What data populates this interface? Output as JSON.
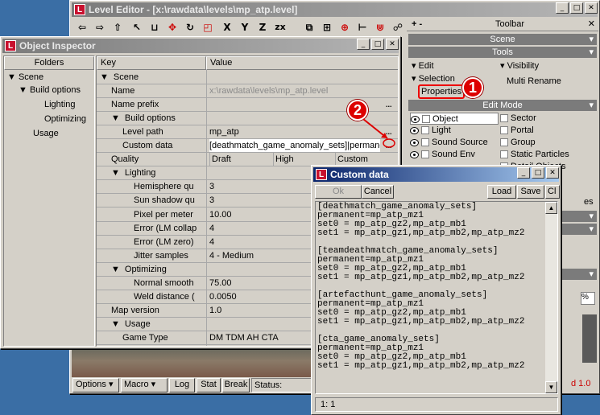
{
  "level_editor": {
    "title": "Level Editor - [x:\\rawdata\\levels\\mp_atp.level]",
    "statusbar": [
      "Options",
      "Macro",
      "Log",
      "Stat",
      "Break",
      "Status:"
    ],
    "status_right": "d 1.0"
  },
  "toolbar_panel": {
    "toolbar_label": "Toolbar",
    "scene_label": "Scene",
    "tools_label": "Tools",
    "edit_label": "Edit",
    "visibility_label": "Visibility",
    "selection_label": "Selection",
    "multi_rename_label": "Multi Rename",
    "properties_label": "Properties",
    "edit_mode_label": "Edit Mode",
    "left_items": [
      "Object",
      "Light",
      "Sound Source",
      "Sound Env"
    ],
    "right_items": [
      "Sector",
      "Portal",
      "Group",
      "Static Particles",
      "Detail Objects"
    ],
    "partial_text": "es",
    "plus_minus": "+ -"
  },
  "object_inspector": {
    "title": "Object Inspector",
    "folders_header": "Folders",
    "folders": [
      {
        "label": "Scene",
        "toggle": "▼"
      },
      {
        "label": "Build options",
        "toggle": "▼"
      },
      {
        "label": "Lighting",
        "toggle": ""
      },
      {
        "label": "Optimizing",
        "toggle": ""
      },
      {
        "label": "Usage",
        "toggle": ""
      }
    ],
    "key_header": "Key",
    "value_header": "Value",
    "rows": [
      {
        "key": "Scene",
        "value": "",
        "toggle": "▼"
      },
      {
        "key": "Name",
        "value": "x:\\rawdata\\levels\\mp_atp.level",
        "toggle": ""
      },
      {
        "key": "Name prefix",
        "value": "",
        "toggle": ""
      },
      {
        "key": "Build options",
        "value": "",
        "toggle": "▼"
      },
      {
        "key": "Level path",
        "value": "mp_atp",
        "toggle": ""
      },
      {
        "key": "Custom data",
        "value": "[deathmatch_game_anomaly_sets]|permanent",
        "toggle": ""
      },
      {
        "key": "Quality",
        "value": "",
        "toggle": ""
      },
      {
        "key": "Lighting",
        "value": "",
        "toggle": "▼"
      },
      {
        "key": "Hemisphere qu",
        "value": "3",
        "toggle": ""
      },
      {
        "key": "Sun shadow qu",
        "value": "3",
        "toggle": ""
      },
      {
        "key": "Pixel per meter",
        "value": "10.00",
        "toggle": ""
      },
      {
        "key": "Error (LM collap",
        "value": "4",
        "toggle": ""
      },
      {
        "key": "Error (LM zero)",
        "value": "4",
        "toggle": ""
      },
      {
        "key": "Jitter samples",
        "value": "4 - Medium",
        "toggle": ""
      },
      {
        "key": "Optimizing",
        "value": "",
        "toggle": "▼"
      },
      {
        "key": "Normal smooth",
        "value": "75.00",
        "toggle": ""
      },
      {
        "key": "Weld distance (",
        "value": "0.0050",
        "toggle": ""
      },
      {
        "key": "Map version",
        "value": "1.0",
        "toggle": ""
      },
      {
        "key": "Usage",
        "value": "",
        "toggle": "▼"
      },
      {
        "key": "Game Type",
        "value": "DM TDM AH CTA",
        "toggle": ""
      }
    ],
    "quality_options": [
      "Draft",
      "High",
      "Custom"
    ],
    "ellipsis": "..."
  },
  "custom_data": {
    "title": "Custom data",
    "ok_label": "Ok",
    "cancel_label": "Cancel",
    "load_label": "Load",
    "save_label": "Save",
    "clear_label": "Cl",
    "lines": [
      "[deathmatch_game_anomaly_sets]",
      "permanent=mp_atp_mz1",
      "set0 = mp_atp_gz2,mp_atp_mb1",
      "set1 = mp_atp_gz1,mp_atp_mb2,mp_atp_mz2",
      "",
      "[teamdeathmatch_game_anomaly_sets]",
      "permanent=mp_atp_mz1",
      "set0 = mp_atp_gz2,mp_atp_mb1",
      "set1 = mp_atp_gz1,mp_atp_mb2,mp_atp_mz2",
      "",
      "[artefacthunt_game_anomaly_sets]",
      "permanent=mp_atp_mz1",
      "set0 = mp_atp_gz2,mp_atp_mb1",
      "set1 = mp_atp_gz1,mp_atp_mb2,mp_atp_mz2",
      "",
      "[cta_game_anomaly_sets]",
      "permanent=mp_atp_mz1",
      "set0 = mp_atp_gz2,mp_atp_mb1",
      "set1 = mp_atp_gz1,mp_atp_mb2,mp_atp_mz2"
    ],
    "cursor_pos": "1:  1"
  },
  "callouts": {
    "one": "1",
    "two": "2"
  },
  "colors": {
    "desktop": "#3a6ea5",
    "callout": "#dd0000",
    "active_title": "#0a246a"
  }
}
